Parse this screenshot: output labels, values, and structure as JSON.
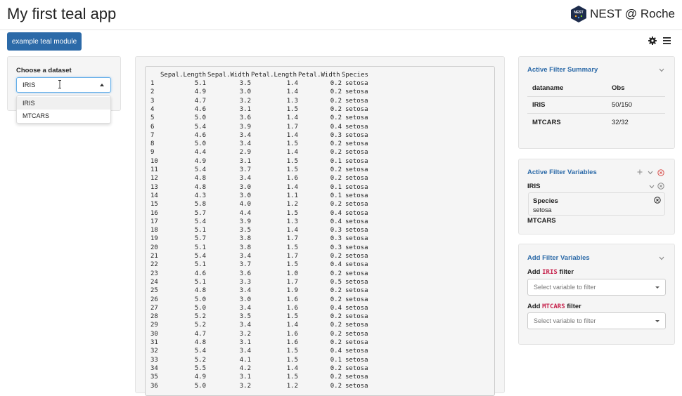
{
  "header": {
    "title": "My first teal app",
    "brand": "NEST @ Roche",
    "logo_text": "NEST"
  },
  "module_button": "example teal module",
  "icons": {
    "settings": "gear-icon",
    "menu": "hamburger-icon"
  },
  "dataset_panel": {
    "label": "Choose a dataset",
    "selected": "IRIS",
    "options": [
      "IRIS",
      "MTCARS"
    ]
  },
  "table": {
    "columns": [
      "Sepal.Length",
      "Sepal.Width",
      "Petal.Length",
      "Petal.Width",
      "Species"
    ],
    "rows": [
      [
        "1",
        "5.1",
        "3.5",
        "1.4",
        "0.2",
        "setosa"
      ],
      [
        "2",
        "4.9",
        "3.0",
        "1.4",
        "0.2",
        "setosa"
      ],
      [
        "3",
        "4.7",
        "3.2",
        "1.3",
        "0.2",
        "setosa"
      ],
      [
        "4",
        "4.6",
        "3.1",
        "1.5",
        "0.2",
        "setosa"
      ],
      [
        "5",
        "5.0",
        "3.6",
        "1.4",
        "0.2",
        "setosa"
      ],
      [
        "6",
        "5.4",
        "3.9",
        "1.7",
        "0.4",
        "setosa"
      ],
      [
        "7",
        "4.6",
        "3.4",
        "1.4",
        "0.3",
        "setosa"
      ],
      [
        "8",
        "5.0",
        "3.4",
        "1.5",
        "0.2",
        "setosa"
      ],
      [
        "9",
        "4.4",
        "2.9",
        "1.4",
        "0.2",
        "setosa"
      ],
      [
        "10",
        "4.9",
        "3.1",
        "1.5",
        "0.1",
        "setosa"
      ],
      [
        "11",
        "5.4",
        "3.7",
        "1.5",
        "0.2",
        "setosa"
      ],
      [
        "12",
        "4.8",
        "3.4",
        "1.6",
        "0.2",
        "setosa"
      ],
      [
        "13",
        "4.8",
        "3.0",
        "1.4",
        "0.1",
        "setosa"
      ],
      [
        "14",
        "4.3",
        "3.0",
        "1.1",
        "0.1",
        "setosa"
      ],
      [
        "15",
        "5.8",
        "4.0",
        "1.2",
        "0.2",
        "setosa"
      ],
      [
        "16",
        "5.7",
        "4.4",
        "1.5",
        "0.4",
        "setosa"
      ],
      [
        "17",
        "5.4",
        "3.9",
        "1.3",
        "0.4",
        "setosa"
      ],
      [
        "18",
        "5.1",
        "3.5",
        "1.4",
        "0.3",
        "setosa"
      ],
      [
        "19",
        "5.7",
        "3.8",
        "1.7",
        "0.3",
        "setosa"
      ],
      [
        "20",
        "5.1",
        "3.8",
        "1.5",
        "0.3",
        "setosa"
      ],
      [
        "21",
        "5.4",
        "3.4",
        "1.7",
        "0.2",
        "setosa"
      ],
      [
        "22",
        "5.1",
        "3.7",
        "1.5",
        "0.4",
        "setosa"
      ],
      [
        "23",
        "4.6",
        "3.6",
        "1.0",
        "0.2",
        "setosa"
      ],
      [
        "24",
        "5.1",
        "3.3",
        "1.7",
        "0.5",
        "setosa"
      ],
      [
        "25",
        "4.8",
        "3.4",
        "1.9",
        "0.2",
        "setosa"
      ],
      [
        "26",
        "5.0",
        "3.0",
        "1.6",
        "0.2",
        "setosa"
      ],
      [
        "27",
        "5.0",
        "3.4",
        "1.6",
        "0.4",
        "setosa"
      ],
      [
        "28",
        "5.2",
        "3.5",
        "1.5",
        "0.2",
        "setosa"
      ],
      [
        "29",
        "5.2",
        "3.4",
        "1.4",
        "0.2",
        "setosa"
      ],
      [
        "30",
        "4.7",
        "3.2",
        "1.6",
        "0.2",
        "setosa"
      ],
      [
        "31",
        "4.8",
        "3.1",
        "1.6",
        "0.2",
        "setosa"
      ],
      [
        "32",
        "5.4",
        "3.4",
        "1.5",
        "0.4",
        "setosa"
      ],
      [
        "33",
        "5.2",
        "4.1",
        "1.5",
        "0.1",
        "setosa"
      ],
      [
        "34",
        "5.5",
        "4.2",
        "1.4",
        "0.2",
        "setosa"
      ],
      [
        "35",
        "4.9",
        "3.1",
        "1.5",
        "0.2",
        "setosa"
      ],
      [
        "36",
        "5.0",
        "3.2",
        "1.2",
        "0.2",
        "setosa"
      ]
    ]
  },
  "filter_summary": {
    "title": "Active Filter Summary",
    "headers": [
      "dataname",
      "Obs"
    ],
    "rows": [
      [
        "IRIS",
        "50/150"
      ],
      [
        "MTCARS",
        "32/32"
      ]
    ]
  },
  "filter_variables": {
    "title": "Active Filter Variables",
    "datasets": [
      {
        "name": "IRIS",
        "variables": [
          {
            "name": "Species",
            "value": "setosa"
          }
        ]
      },
      {
        "name": "MTCARS"
      }
    ]
  },
  "add_filter": {
    "title": "Add Filter Variables",
    "items": [
      {
        "prefix": "Add",
        "dataset": "IRIS",
        "suffix": "filter",
        "placeholder": "Select variable to filter"
      },
      {
        "prefix": "Add",
        "dataset": "MTCARS",
        "suffix": "filter",
        "placeholder": "Select variable to filter"
      }
    ]
  },
  "colors": {
    "primary": "#2c6aa8",
    "code_red": "#c7254e",
    "remove_red": "#d9534f"
  }
}
